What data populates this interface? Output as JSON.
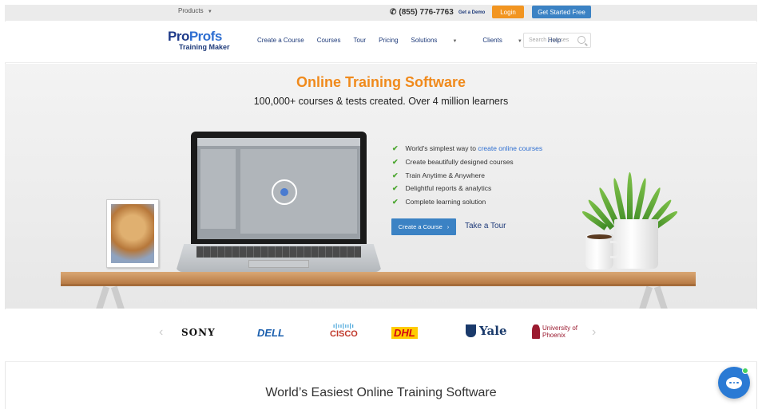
{
  "topbar": {
    "products_label": "Products",
    "phone": "(855) 776-7763",
    "demo_label": "Get a Demo",
    "login_label": "Login",
    "start_label": "Get Started Free"
  },
  "nav": {
    "logo_pro": "Pro",
    "logo_profs": "Profs",
    "logo_sub": "Training Maker",
    "items": [
      {
        "label": "Create a Course"
      },
      {
        "label": "Courses"
      },
      {
        "label": "Tour"
      },
      {
        "label": "Pricing"
      },
      {
        "label": "Solutions",
        "dropdown": true
      },
      {
        "label": "Clients",
        "dropdown": true
      },
      {
        "label": "Help"
      }
    ],
    "search_placeholder": "Search Courses"
  },
  "hero": {
    "title": "Online Training Software",
    "subtitle": "100,000+ courses & tests created. Over 4 million learners",
    "features": [
      {
        "text": "World's simplest way to ",
        "link": "create online courses"
      },
      {
        "text": "Create beautifully designed courses",
        "link": ""
      },
      {
        "text": "Train Anytime & Anywhere",
        "link": ""
      },
      {
        "text": "Delightful reports & analytics",
        "link": ""
      },
      {
        "text": "Complete learning solution",
        "link": ""
      }
    ],
    "cta_label": "Create a Course",
    "tour_label": "Take a Tour"
  },
  "logos": {
    "sony": "SONY",
    "dell": "DELL",
    "cisco_bars": "ı|ıı|ıı|ı",
    "cisco": "CISCO",
    "dhl": "DHL",
    "yale": "Yale",
    "phoenix": "University of Phoenix"
  },
  "section_title": "World’s Easiest Online Training Software",
  "colors": {
    "accent_orange": "#f29521",
    "primary_blue": "#3b82c4",
    "navy": "#1f3b7a"
  }
}
